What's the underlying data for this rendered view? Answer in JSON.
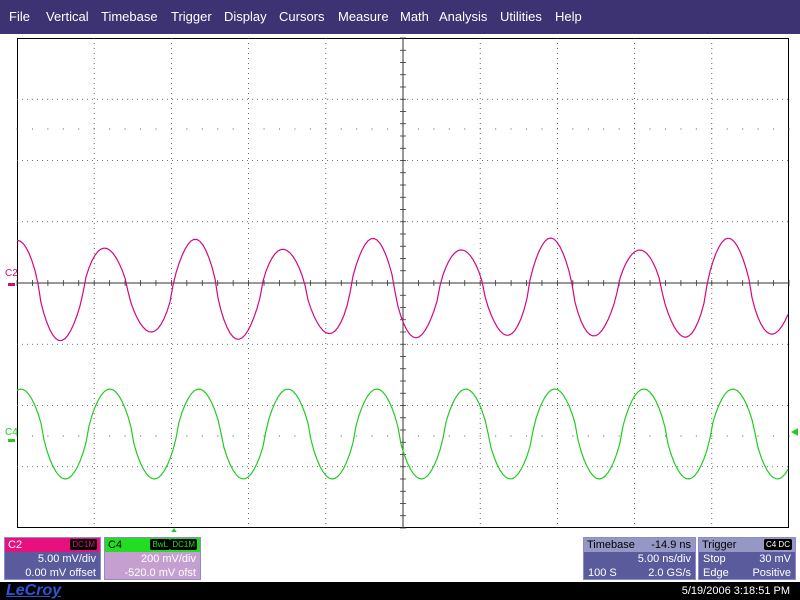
{
  "menu": [
    "File",
    "Vertical",
    "Timebase",
    "Trigger",
    "Display",
    "Cursors",
    "Measure",
    "Math",
    "Analysis",
    "Utilities",
    "Help"
  ],
  "traces": {
    "c2": {
      "label": "C2",
      "color": "#d4087f"
    },
    "c4": {
      "label": "C4",
      "color": "#22cc22"
    }
  },
  "c2_panel": {
    "name": "C2",
    "coupling": "DC1M",
    "vdiv": "5.00 mV/div",
    "offset": "0.00 mV offset"
  },
  "c4_panel": {
    "name": "C4",
    "bwl": "BwL",
    "coupling": "DC1M",
    "vdiv": "200 mV/div",
    "offset": "-520.0 mV ofst"
  },
  "timebase": {
    "title": "Timebase",
    "delay": "-14.9 ns",
    "tdiv": "5.00 ns/div",
    "samples": "100 S",
    "rate": "2.0 GS/s"
  },
  "trigger": {
    "title": "Trigger",
    "badge": "C4 DC",
    "mode": "Stop",
    "level": "30 mV",
    "type": "Edge",
    "slope": "Positive"
  },
  "status": {
    "logo": "LeCroy",
    "datetime": "5/19/2006 3:18:51 PM"
  }
}
